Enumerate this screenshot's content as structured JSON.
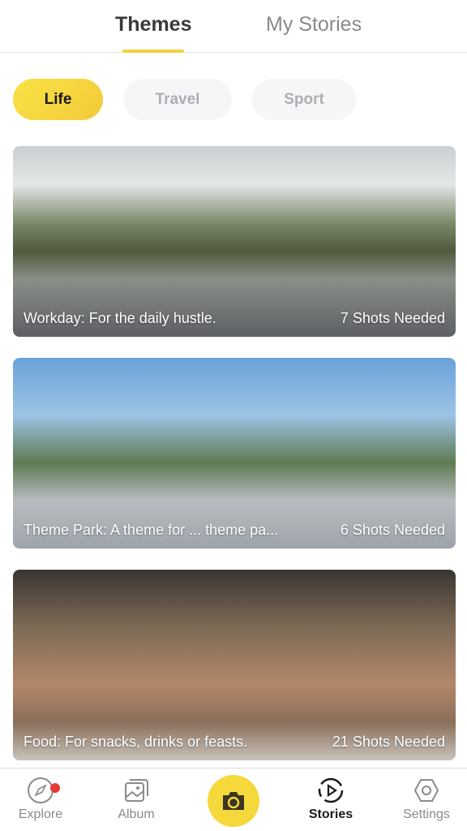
{
  "header": {
    "tabs": [
      {
        "label": "Themes",
        "active": true
      },
      {
        "label": "My Stories",
        "active": false
      }
    ]
  },
  "categories": [
    {
      "label": "Life",
      "selected": true
    },
    {
      "label": "Travel",
      "selected": false
    },
    {
      "label": "Sport",
      "selected": false
    }
  ],
  "themes": [
    {
      "title": "Workday: For the daily hustle.",
      "shots": "7 Shots Needed"
    },
    {
      "title": "Theme Park: A theme for ... theme pa...",
      "shots": "6 Shots Needed"
    },
    {
      "title": "Food: For snacks, drinks or feasts.",
      "shots": "21 Shots Needed"
    }
  ],
  "nav": {
    "items": [
      {
        "label": "Explore",
        "icon": "compass-icon",
        "badge": true
      },
      {
        "label": "Album",
        "icon": "album-icon"
      },
      {
        "label": "",
        "icon": "camera-icon"
      },
      {
        "label": "Stories",
        "icon": "stories-icon",
        "active": true
      },
      {
        "label": "Settings",
        "icon": "settings-icon"
      }
    ]
  },
  "colors": {
    "accent": "#f3d03c",
    "badge": "#e53935"
  }
}
